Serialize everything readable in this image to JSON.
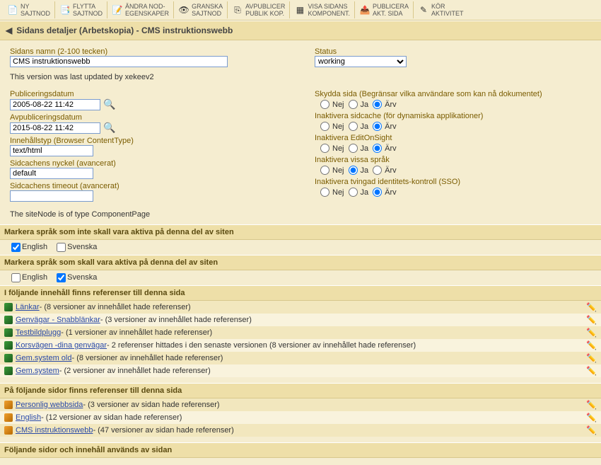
{
  "toolbar": [
    {
      "id": "new-sitenode",
      "icon": "📄",
      "label": "NY\nSAJTNOD"
    },
    {
      "id": "move-sitenode",
      "icon": "📑",
      "label": "FLYTTA\nSAJTNOD"
    },
    {
      "id": "edit-node-props",
      "icon": "📝",
      "label": "ÄNDRA NOD-\nEGENSKAPER"
    },
    {
      "id": "review-sitenode",
      "icon": "👁",
      "label": "GRANSKA\nSAJTNOD"
    },
    {
      "id": "unpublish-public-copy",
      "icon": "⎘",
      "label": "AVPUBLICER\nPUBLIK KOP."
    },
    {
      "id": "show-page-components",
      "icon": "▦",
      "label": "VISA SIDANS\nKOMPONENT."
    },
    {
      "id": "publish-current-page",
      "icon": "📤",
      "label": "PUBLICERA\nAKT. SIDA"
    },
    {
      "id": "run-activity",
      "icon": "✎",
      "label": "KÖR\nAKTIVITET"
    }
  ],
  "title": "Sidans detaljer (Arbetskopia) - CMS instruktionswebb",
  "sidans_namn_label": "Sidans namn (2-100 tecken)",
  "sidans_namn_value": "CMS instruktionswebb",
  "status_label": "Status",
  "status_value": "working",
  "last_updated_note": "This version was last updated by xekeev2",
  "pub_label": "Publiceringsdatum",
  "pub_value": "2005-08-22 11:42",
  "unpub_label": "Avpubliceringsdatum",
  "unpub_value": "2015-08-22 11:42",
  "contenttype_label": "Innehållstyp (Browser ContentType)",
  "contenttype_value": "text/html",
  "cachekey_label": "Sidcachens nyckel (avancerat)",
  "cachekey_value": "default",
  "cachetimeout_label": "Sidcachens timeout (avancerat)",
  "cachetimeout_value": "",
  "nodetype_note": "The siteNode is of type ComponentPage",
  "radio_nej": "Nej",
  "radio_ja": "Ja",
  "radio_arv": "Ärv",
  "rgroups": [
    {
      "key": "protect",
      "label": "Skydda sida (Begränsar vilka användare som kan nå dokumentet)",
      "sel": "arv"
    },
    {
      "key": "nocache",
      "label": "Inaktivera sidcache (för dynamiska applikationer)",
      "sel": "arv"
    },
    {
      "key": "noeos",
      "label": "Inaktivera EditOnSight",
      "sel": "arv"
    },
    {
      "key": "nolang",
      "label": "Inaktivera vissa språk",
      "sel": "ja"
    },
    {
      "key": "nosso",
      "label": "Inaktivera tvingad identitets-kontroll (SSO)",
      "sel": "arv"
    }
  ],
  "section_inactive": "Markera språk som inte skall vara aktiva på denna del av siten",
  "section_active": "Markera språk som skall vara aktiva på denna del av siten",
  "lang_en": "English",
  "lang_sv": "Svenska",
  "checks_inactive_en": true,
  "checks_inactive_sv": false,
  "checks_active_en": false,
  "checks_active_sv": true,
  "section_content_refs": "I följande innehåll finns referenser till denna sida",
  "content_refs": [
    {
      "name": "Länkar",
      "rest": " - (8 versioner av innehållet hade referenser)"
    },
    {
      "name": "Genvägar - Snabblänkar",
      "rest": " - (3 versioner av innehållet hade referenser)"
    },
    {
      "name": "Testbildplugg",
      "rest": " - (1 versioner av innehållet hade referenser)"
    },
    {
      "name": "Korsvägen -dina genvägar",
      "rest": " - 2 referenser hittades i den senaste versionen (8 versioner av innehållet hade referenser)"
    },
    {
      "name": "Gem.system old",
      "rest": " - (8 versioner av innehållet hade referenser)"
    },
    {
      "name": "Gem.system",
      "rest": " - (2 versioner av innehållet hade referenser)"
    }
  ],
  "section_page_refs": "På följande sidor finns referenser till denna sida",
  "page_refs": [
    {
      "name": "Personlig webbsida",
      "rest": " - (3 versioner av sidan hade referenser)"
    },
    {
      "name": "English",
      "rest": " - (12 versioner av sidan hade referenser)"
    },
    {
      "name": "CMS instruktionswebb",
      "rest": " - (47 versioner av sidan hade referenser)"
    }
  ],
  "section_used": "Följande sidor och innehåll används av sidan"
}
